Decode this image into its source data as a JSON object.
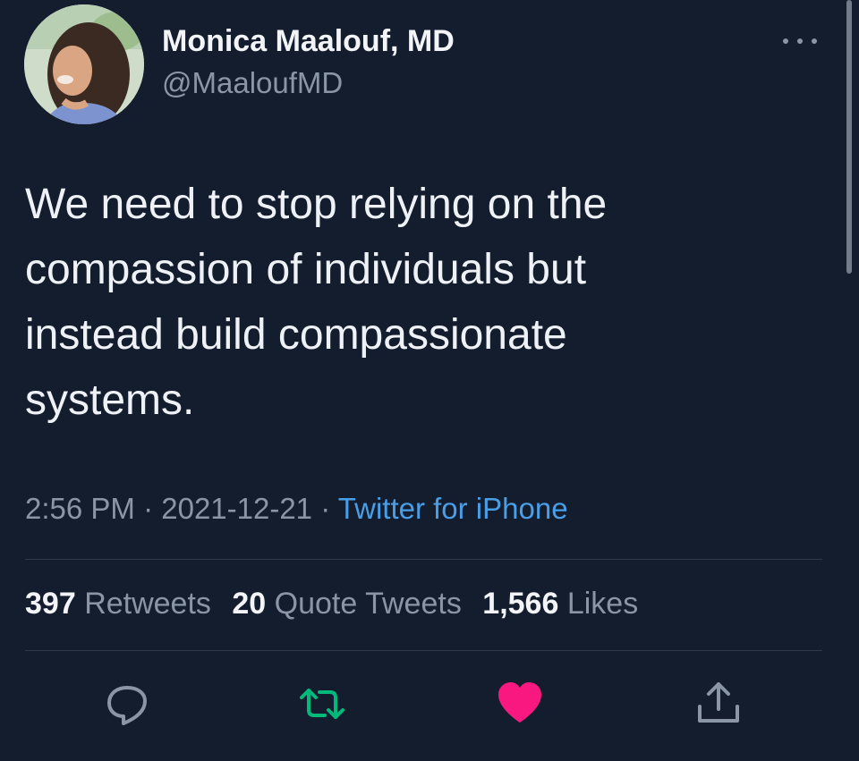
{
  "author": {
    "name": "Monica Maalouf, MD",
    "handle": "@MaaloufMD"
  },
  "tweet": {
    "text_lines": [
      "We need to stop relying on the",
      "compassion of individuals but",
      "instead build compassionate",
      "systems."
    ]
  },
  "meta": {
    "time": "2:56 PM",
    "separator_1": " · ",
    "date": "2021-12-21",
    "separator_2": " · ",
    "source": "Twitter for iPhone"
  },
  "stats": {
    "retweets_count": "397",
    "retweets_label": "Retweets",
    "quotes_count": "20",
    "quotes_label": "Quote Tweets",
    "likes_count": "1,566",
    "likes_label": "Likes"
  },
  "actions": {
    "reply_icon": "reply-icon",
    "retweet_icon": "retweet-icon",
    "like_icon": "heart-icon",
    "share_icon": "share-icon"
  },
  "colors": {
    "background": "#141d2e",
    "text": "#eef1f5",
    "secondary_text": "#8a96a5",
    "link": "#4a9ee6",
    "retweet_accent": "#00ba7c",
    "like_accent": "#f91880"
  }
}
